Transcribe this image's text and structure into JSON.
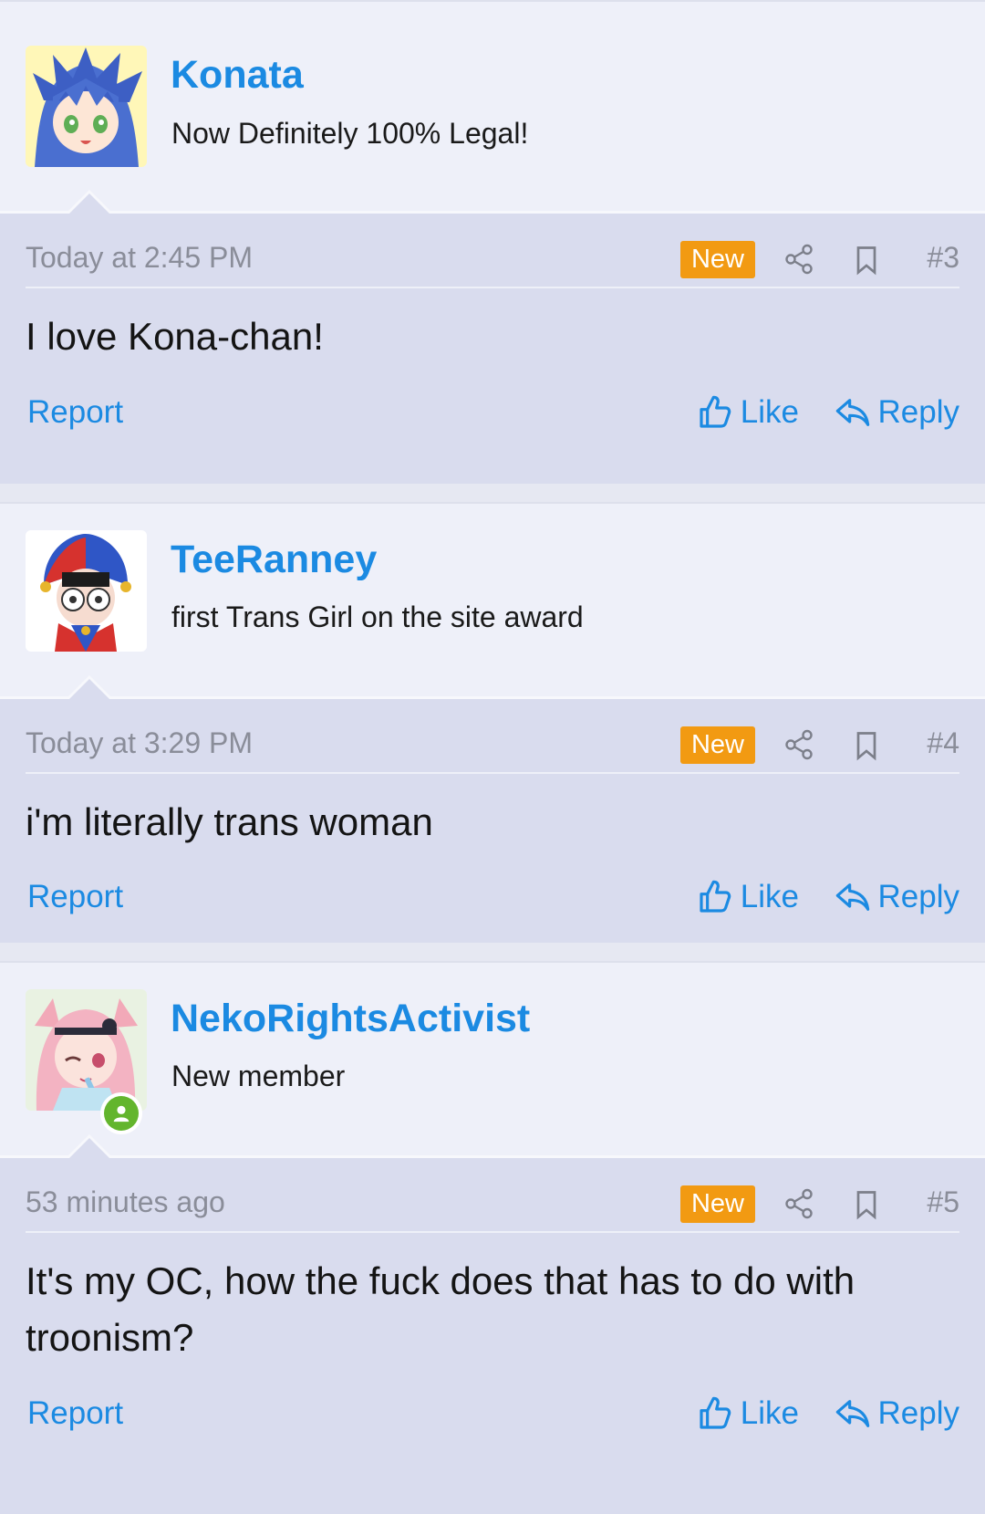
{
  "posts": [
    {
      "username": "Konata",
      "user_title": "Now Definitely 100% Legal!",
      "timestamp": "Today at 2:45 PM",
      "new_badge": "New",
      "post_number": "#3",
      "message": "I love Kona-chan!",
      "avatar_icon": "konata-avatar",
      "online": false
    },
    {
      "username": "TeeRanney",
      "user_title": "first Trans Girl on the site award",
      "timestamp": "Today at 3:29 PM",
      "new_badge": "New",
      "post_number": "#4",
      "message": "i'm literally trans woman",
      "avatar_icon": "jester-avatar",
      "online": false
    },
    {
      "username": "NekoRightsActivist",
      "user_title": "New member",
      "timestamp": "53 minutes ago",
      "new_badge": "New",
      "post_number": "#5",
      "message": "It's my OC, how the fuck does that has to do with troonism?",
      "avatar_icon": "neko-avatar",
      "online": true
    }
  ],
  "actions": {
    "report": "Report",
    "like": "Like",
    "reply": "Reply"
  },
  "icons": {
    "share": "share-icon",
    "bookmark": "bookmark-icon",
    "like": "thumbs-up-icon",
    "reply": "reply-arrow-icon",
    "online": "user-online-icon"
  },
  "colors": {
    "link": "#1b8ae2",
    "badge": "#f29a12",
    "content_bg": "#d9dcee",
    "user_bg": "#eef0f9",
    "online": "#63b52d"
  }
}
